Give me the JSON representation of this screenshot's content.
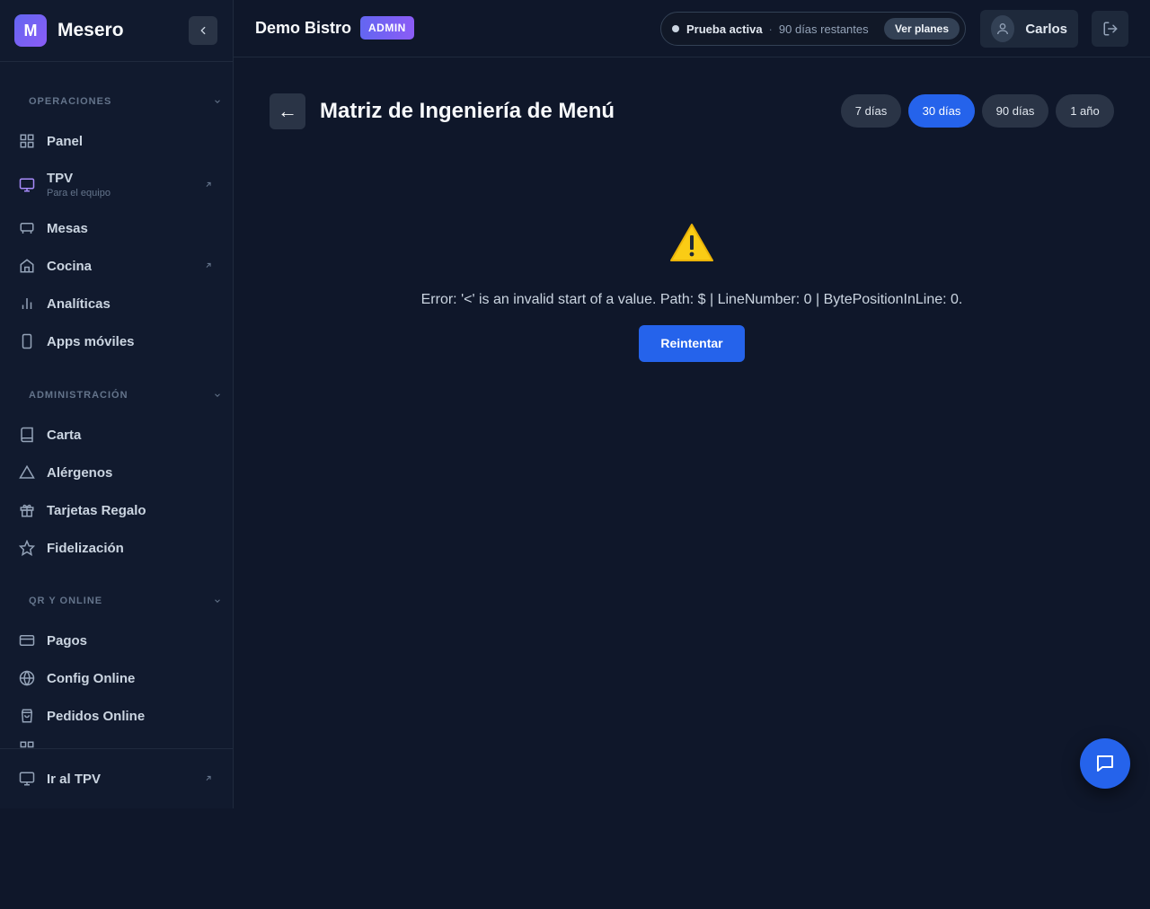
{
  "brand": {
    "logo_letter": "M",
    "name": "Mesero"
  },
  "sidebar": {
    "sections": [
      {
        "title": "OPERACIONES",
        "items": [
          {
            "label": "Panel",
            "icon": "grid-icon"
          },
          {
            "label": "TPV",
            "sublabel": "Para el equipo",
            "icon": "monitor-icon",
            "external": true
          },
          {
            "label": "Mesas",
            "icon": "table-icon"
          },
          {
            "label": "Cocina",
            "icon": "home-icon",
            "external": true
          },
          {
            "label": "Analíticas",
            "icon": "bar-chart-icon"
          },
          {
            "label": "Apps móviles",
            "icon": "smartphone-icon"
          }
        ]
      },
      {
        "title": "ADMINISTRACIÓN",
        "items": [
          {
            "label": "Carta",
            "icon": "book-icon"
          },
          {
            "label": "Alérgenos",
            "icon": "warning-triangle-icon"
          },
          {
            "label": "Tarjetas Regalo",
            "icon": "gift-icon"
          },
          {
            "label": "Fidelización",
            "icon": "star-icon"
          }
        ]
      },
      {
        "title": "QR Y ONLINE",
        "items": [
          {
            "label": "Pagos",
            "icon": "credit-card-icon"
          },
          {
            "label": "Config Online",
            "icon": "globe-icon"
          },
          {
            "label": "Pedidos Online",
            "icon": "shopping-bag-icon"
          }
        ]
      }
    ],
    "footer": {
      "label": "Ir al TPV",
      "icon": "monitor-icon"
    }
  },
  "header": {
    "restaurant_name": "Demo Bistro",
    "role_badge": "ADMIN",
    "trial": {
      "status": "Prueba activa",
      "separator": "·",
      "remaining": "90 días restantes",
      "plans_button": "Ver planes"
    },
    "user_name": "Carlos"
  },
  "main": {
    "title": "Matriz de Ingeniería de Menú",
    "periods": [
      {
        "label": "7 días",
        "active": false
      },
      {
        "label": "30 días",
        "active": true
      },
      {
        "label": "90 días",
        "active": false
      },
      {
        "label": "1 año",
        "active": false
      }
    ],
    "error_message": "Error: '<' is an invalid start of a value. Path: $ | LineNumber: 0 | BytePositionInLine: 0.",
    "retry_label": "Reintentar"
  },
  "colors": {
    "accent": "#2563eb",
    "background": "#0f172a",
    "sidebar": "#111a2e",
    "brand_gradient": "#6366f1"
  }
}
